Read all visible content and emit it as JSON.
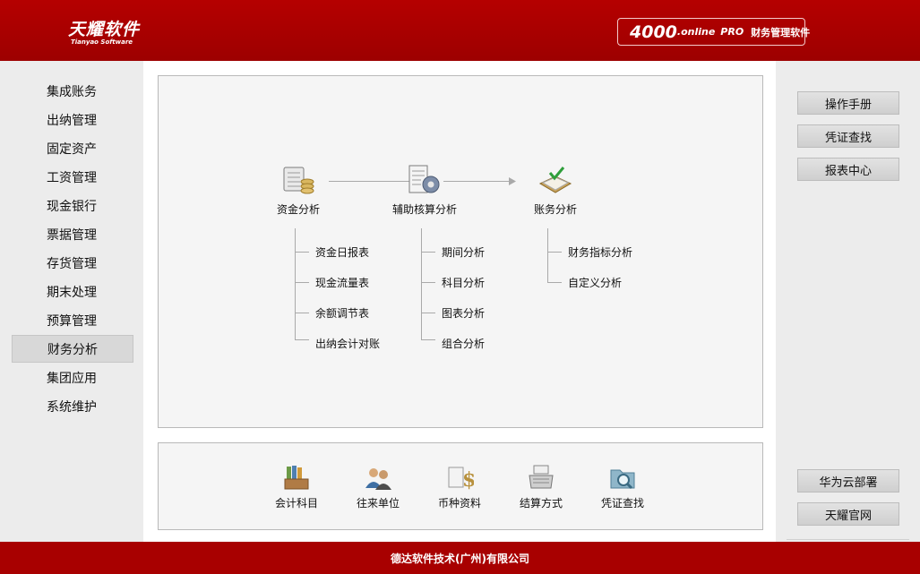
{
  "header": {
    "logo_cn": "天耀软件",
    "logo_en": "Tianyao Software",
    "badge_version": "4000",
    "badge_online": ".online",
    "badge_pro": "PRO",
    "badge_desc": "财务管理软件"
  },
  "sidebar": {
    "items": [
      {
        "label": "集成账务"
      },
      {
        "label": "出纳管理"
      },
      {
        "label": "固定资产"
      },
      {
        "label": "工资管理"
      },
      {
        "label": "现金银行"
      },
      {
        "label": "票据管理"
      },
      {
        "label": "存货管理"
      },
      {
        "label": "期末处理"
      },
      {
        "label": "预算管理"
      },
      {
        "label": "财务分析",
        "active": true
      },
      {
        "label": "集团应用"
      },
      {
        "label": "系统维护"
      }
    ]
  },
  "analysis": {
    "groups": [
      {
        "label": "资金分析",
        "icon": "ledger-coins-icon",
        "items": [
          "资金日报表",
          "现金流量表",
          "余额调节表",
          "出纳会计对账"
        ]
      },
      {
        "label": "辅助核算分析",
        "icon": "document-gear-icon",
        "items": [
          "期间分析",
          "科目分析",
          "图表分析",
          "组合分析"
        ]
      },
      {
        "label": "账务分析",
        "icon": "book-check-icon",
        "items": [
          "财务指标分析",
          "自定义分析"
        ]
      }
    ]
  },
  "shortcuts": [
    {
      "label": "会计科目",
      "icon": "file-folders-icon"
    },
    {
      "label": "往来单位",
      "icon": "contacts-icon"
    },
    {
      "label": "币种资料",
      "icon": "currency-icon"
    },
    {
      "label": "结算方式",
      "icon": "cash-register-icon"
    },
    {
      "label": "凭证查找",
      "icon": "folder-search-icon"
    }
  ],
  "right_top": [
    "操作手册",
    "凭证查找",
    "报表中心"
  ],
  "right_bottom": [
    "华为云部署",
    "天耀官网"
  ],
  "footer": {
    "text": "德达软件技术(广州)有限公司"
  },
  "colors": {
    "brand_red": "#a80000",
    "active_bg": "#d8d8d8"
  }
}
